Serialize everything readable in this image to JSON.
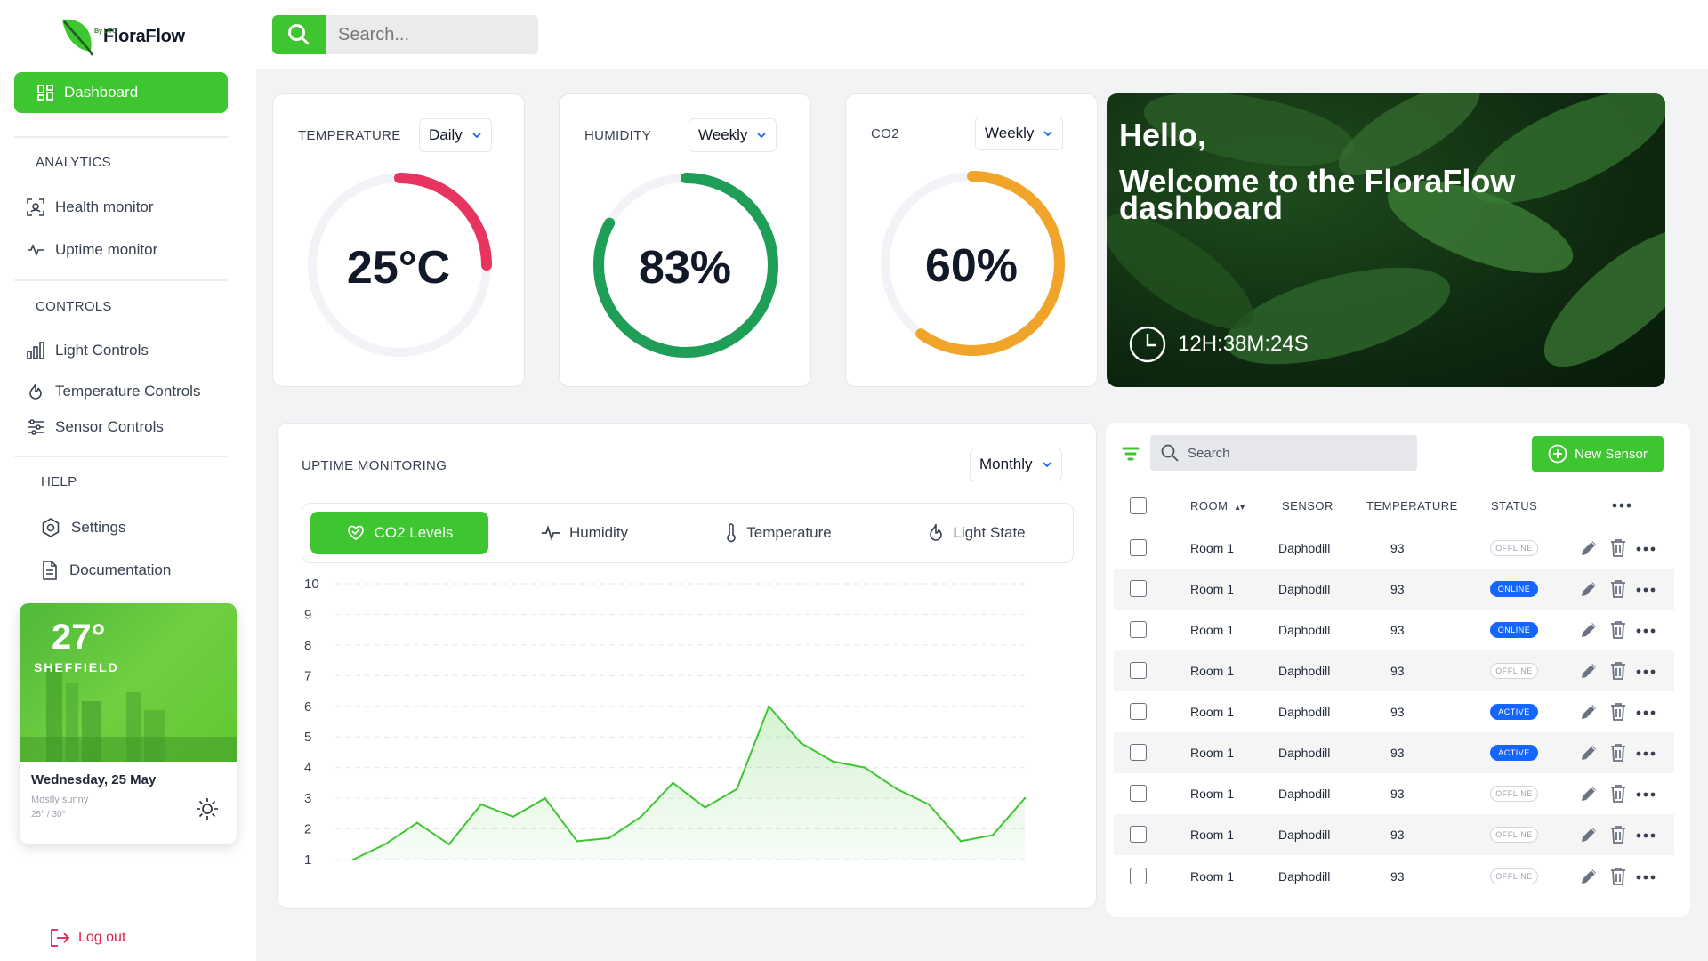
{
  "app": {
    "name": "FloraFlow",
    "byline": "By UTC"
  },
  "sidebar": {
    "dashboard": "Dashboard",
    "analytics_title": "ANALYTICS",
    "health": "Health monitor",
    "uptime": "Uptime monitor",
    "controls_title": "CONTROLS",
    "light": "Light Controls",
    "temperature": "Temperature Controls",
    "sensor": "Sensor Controls",
    "help_title": "HELP",
    "settings": "Settings",
    "docs": "Documentation",
    "logout": "Log out"
  },
  "weather": {
    "temp": "27°",
    "city": "SHEFFIELD",
    "date": "Wednesday, 25 May",
    "desc": "Mostly sunny",
    "range": "25° / 30°"
  },
  "search": {
    "placeholder": "Search..."
  },
  "gauges": [
    {
      "title": "TEMPERATURE",
      "period": "Daily",
      "value": "25°C",
      "fraction": 0.25,
      "color": "#e8345f"
    },
    {
      "title": "HUMIDITY",
      "period": "Weekly",
      "value": "83%",
      "fraction": 0.83,
      "color": "#1f9e58"
    },
    {
      "title": "CO2",
      "period": "Weekly",
      "value": "60%",
      "fraction": 0.6,
      "color": "#f0a429"
    }
  ],
  "hero": {
    "hello": "Hello,",
    "welcome": "Welcome to the FloraFlow dashboard",
    "timer": "12H:38M:24S"
  },
  "uptime": {
    "title": "UPTIME MONITORING",
    "period": "Monthly",
    "tabs": [
      "CO2 Levels",
      "Humidity",
      "Temperature",
      "Light State"
    ]
  },
  "chart_data": {
    "type": "area",
    "y_ticks": [
      10,
      9,
      8,
      7,
      6,
      5,
      4,
      3,
      2,
      1
    ],
    "ylim": [
      1,
      10
    ],
    "grid": true,
    "series": [
      {
        "values": [
          1.0,
          1.5,
          2.2,
          1.5,
          2.8,
          2.4,
          3.0,
          1.6,
          1.7,
          2.4,
          3.5,
          2.7,
          3.3,
          6.0,
          4.8,
          4.2,
          4.0,
          3.3,
          2.8,
          1.6,
          1.8,
          3.0
        ]
      }
    ],
    "color": "#3ec631"
  },
  "table": {
    "search_placeholder": "Search",
    "new_button": "New Sensor",
    "headers": {
      "room": "ROOM",
      "sensor": "SENSOR",
      "temperature": "TEMPERATURE",
      "status": "STATUS"
    },
    "rows": [
      {
        "room": "Room 1",
        "sensor": "Daphodill",
        "temp": "93",
        "status": "OFFLINE"
      },
      {
        "room": "Room 1",
        "sensor": "Daphodill",
        "temp": "93",
        "status": "ONLINE"
      },
      {
        "room": "Room 1",
        "sensor": "Daphodill",
        "temp": "93",
        "status": "ONLINE"
      },
      {
        "room": "Room 1",
        "sensor": "Daphodill",
        "temp": "93",
        "status": "OFFLINE"
      },
      {
        "room": "Room 1",
        "sensor": "Daphodill",
        "temp": "93",
        "status": "ACTIVE"
      },
      {
        "room": "Room 1",
        "sensor": "Daphodill",
        "temp": "93",
        "status": "ACTIVE"
      },
      {
        "room": "Room 1",
        "sensor": "Daphodill",
        "temp": "93",
        "status": "OFFLINE"
      },
      {
        "room": "Room 1",
        "sensor": "Daphodill",
        "temp": "93",
        "status": "OFFLINE"
      },
      {
        "room": "Room 1",
        "sensor": "Daphodill",
        "temp": "93",
        "status": "OFFLINE"
      }
    ]
  }
}
